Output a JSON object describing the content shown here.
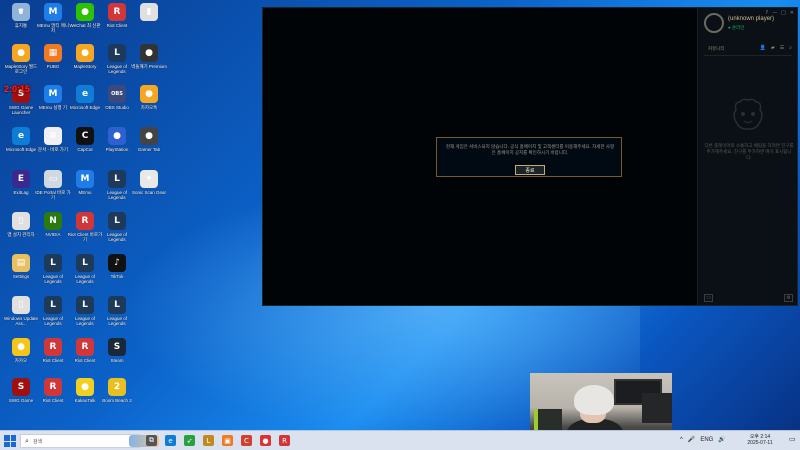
{
  "desktop_icons": [
    {
      "label": "휴지통",
      "glyph": "🗑",
      "color": "#8fb4d8"
    },
    {
      "label": "MEmu 멀티\n매니저",
      "glyph": "M",
      "color": "#1e7de8"
    },
    {
      "label": "WeChat 최\n신판",
      "glyph": "●",
      "color": "#2dc100"
    },
    {
      "label": "Riot Client",
      "glyph": "R",
      "color": "#d13639"
    },
    {
      "label": "",
      "glyph": "▮",
      "color": "#e0e0e0"
    },
    {
      "label": "MapleStory 월드 로그인",
      "glyph": "●",
      "color": "#f5a623"
    },
    {
      "label": "PUBG",
      "glyph": "▦",
      "color": "#f07a22"
    },
    {
      "label": "MapleStory",
      "glyph": "●",
      "color": "#f5a623"
    },
    {
      "label": "League of Legends",
      "glyph": "L",
      "color": "#1e3a5a"
    },
    {
      "label": "벽돌깨기 Premium",
      "glyph": "●",
      "color": "#333333"
    },
    {
      "label": "SWG Game Launcher",
      "glyph": "S",
      "color": "#a01010"
    },
    {
      "label": "MEmu 실행\n기",
      "glyph": "M",
      "color": "#1e7de8"
    },
    {
      "label": "Microsoft Edge",
      "glyph": "e",
      "color": "#0f7cd6"
    },
    {
      "label": "OBS Studio",
      "glyph": "OBS",
      "color": "#3b4a7a"
    },
    {
      "label": "카카오톡",
      "glyph": "●",
      "color": "#f5a623"
    },
    {
      "label": "Microsoft Edge",
      "glyph": "e",
      "color": "#0f7cd6"
    },
    {
      "label": "문서 - 바로 가기",
      "glyph": "≡",
      "color": "#f0f0f0"
    },
    {
      "label": "CapCut",
      "glyph": "C",
      "color": "#111111"
    },
    {
      "label": "PlayStation",
      "glyph": "●",
      "color": "#3060d0"
    },
    {
      "label": "Gamer Tab",
      "glyph": "●",
      "color": "#444444"
    },
    {
      "label": "ExitLag",
      "glyph": "E",
      "color": "#3a2a90"
    },
    {
      "label": "IDE Portal 바로 가기",
      "glyph": "▭",
      "color": "#d0d8e0"
    },
    {
      "label": "MEmu",
      "glyph": "M",
      "color": "#1e7de8"
    },
    {
      "label": "League of Legends",
      "glyph": "L",
      "color": "#1e3a5a"
    },
    {
      "label": "Sonic Scan Gear",
      "glyph": "✦",
      "color": "#e8e8e8"
    },
    {
      "label": "앱 설치 관리자",
      "glyph": "▯",
      "color": "#e0e0e0"
    },
    {
      "label": "NVIDIA",
      "glyph": "N",
      "color": "#2a7a10"
    },
    {
      "label": "Riot Client 바로가기",
      "glyph": "R",
      "color": "#d13639"
    },
    {
      "label": "League of Legends",
      "glyph": "L",
      "color": "#1e3a5a"
    },
    {
      "label": "",
      "glyph": "",
      "color": "transparent"
    },
    {
      "label": "Settings",
      "glyph": "▤",
      "color": "#e8c060"
    },
    {
      "label": "League of Legends",
      "glyph": "L",
      "color": "#1e3a5a"
    },
    {
      "label": "League of Legends",
      "glyph": "L",
      "color": "#1e3a5a"
    },
    {
      "label": "TikTok",
      "glyph": "♪",
      "color": "#111111"
    },
    {
      "label": "",
      "glyph": "",
      "color": "transparent"
    },
    {
      "label": "Windows Update Ass...",
      "glyph": "▯",
      "color": "#e0e0e0"
    },
    {
      "label": "League of Legends",
      "glyph": "L",
      "color": "#1e3a5a"
    },
    {
      "label": "League of Legends",
      "glyph": "L",
      "color": "#1e3a5a"
    },
    {
      "label": "League of Legends",
      "glyph": "L",
      "color": "#1e3a5a"
    },
    {
      "label": "",
      "glyph": "",
      "color": "transparent"
    },
    {
      "label": "카카오",
      "glyph": "●",
      "color": "#f5c518"
    },
    {
      "label": "Riot Client",
      "glyph": "R",
      "color": "#d13639"
    },
    {
      "label": "Riot Client",
      "glyph": "R",
      "color": "#d13639"
    },
    {
      "label": "Steam",
      "glyph": "S",
      "color": "#1b2838"
    },
    {
      "label": "",
      "glyph": "",
      "color": "transparent"
    },
    {
      "label": "SWG Game",
      "glyph": "S",
      "color": "#a01010"
    },
    {
      "label": "Riot Client",
      "glyph": "R",
      "color": "#d13639"
    },
    {
      "label": "KakaoTalk",
      "glyph": "●",
      "color": "#f0d020"
    },
    {
      "label": "Boom Beach 2",
      "glyph": "2",
      "color": "#e8c020"
    }
  ],
  "overlay_text": "2:0:15",
  "client": {
    "player_name": "(unknown player)",
    "player_status": "● 온라인",
    "social_label": "커뮤니티",
    "side_message": "다른 플레이어와 소통하고 채팅을 하려면 친구를 추가해주세요. 친구를 추가하면 여기 표시됩니다.",
    "window_controls": [
      "?",
      "—",
      "□",
      "✕"
    ],
    "dialog": {
      "message": "현재 게임은 서비스되지 않습니다. 공식 홈페이지 및 고객센터를 이용해주세요. 자세한 사항은 홈페이지 공지를 확인하시기 바랍니다.",
      "button_label": "종료"
    }
  },
  "taskbar": {
    "search_placeholder": "검색",
    "apps": [
      {
        "name": "task-view",
        "glyph": "⧉",
        "color": "#555555"
      },
      {
        "name": "edge",
        "glyph": "e",
        "color": "#0f7cd6"
      },
      {
        "name": "feather",
        "glyph": "➶",
        "color": "#2aa040"
      },
      {
        "name": "league",
        "glyph": "L",
        "color": "#c08a20"
      },
      {
        "name": "orange-app",
        "glyph": "▣",
        "color": "#f07a22"
      },
      {
        "name": "capcut",
        "glyph": "C",
        "color": "#d04030"
      },
      {
        "name": "red-app",
        "glyph": "●",
        "color": "#e03030"
      },
      {
        "name": "riot",
        "glyph": "R",
        "color": "#d13639"
      }
    ],
    "tray_items": [
      "^",
      "🎤",
      "ENG",
      "🔊"
    ],
    "time": "오후 2:14",
    "date": "2025-07-11"
  },
  "colors": {
    "client_bg": "#010a13",
    "gold_border": "#785a28",
    "button_border": "#c8aa6e",
    "status_green": "#1bb25a"
  }
}
